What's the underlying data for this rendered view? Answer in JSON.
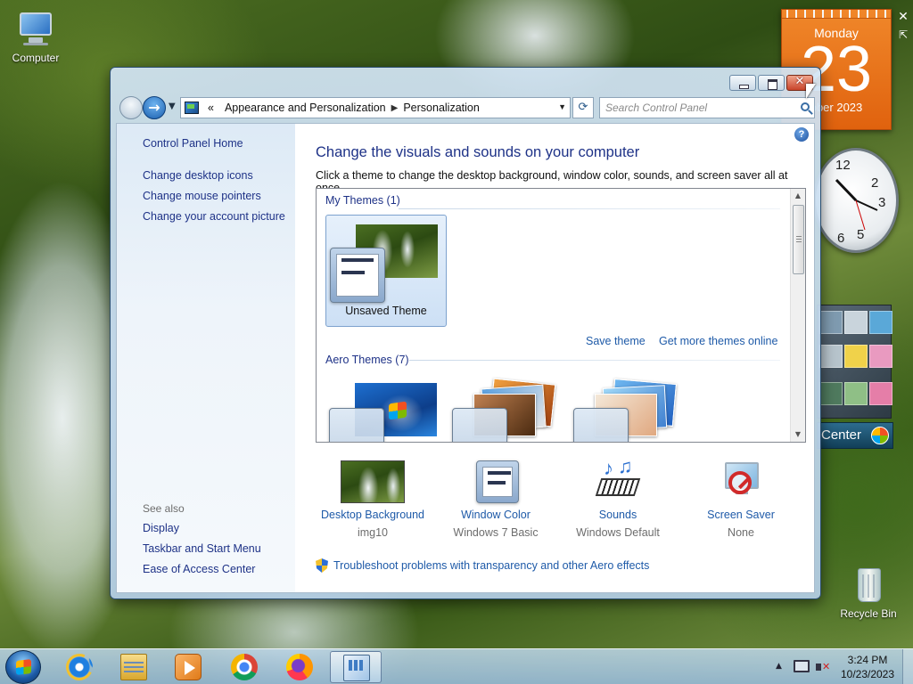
{
  "desktop": {
    "icons": [
      {
        "label": "Computer",
        "icon": "computer-icon"
      },
      {
        "label": "Recycle Bin",
        "icon": "recycle-bin-icon"
      }
    ]
  },
  "gadgets": {
    "calendar": {
      "weekday": "Monday",
      "day": "23",
      "month_year": "ober 2023"
    },
    "clock": {
      "numerals": [
        "12",
        "2",
        "3",
        "5",
        "6"
      ]
    },
    "media_center": {
      "label": "Center"
    }
  },
  "window": {
    "address": {
      "overflow": "«",
      "segments": [
        "Appearance and Personalization",
        "Personalization"
      ],
      "search_placeholder": "Search Control Panel"
    },
    "left_pane": {
      "home": "Control Panel Home",
      "links": [
        "Change desktop icons",
        "Change mouse pointers",
        "Change your account picture"
      ],
      "see_also_label": "See also",
      "see_also": [
        "Display",
        "Taskbar and Start Menu",
        "Ease of Access Center"
      ]
    },
    "main": {
      "title": "Change the visuals and sounds on your computer",
      "subtitle": "Click a theme to change the desktop background, window color, sounds, and screen saver all at once.",
      "my_themes_header": "My Themes (1)",
      "unsaved_theme": "Unsaved Theme",
      "save_theme": "Save theme",
      "get_more": "Get more themes online",
      "aero_header": "Aero Themes (7)"
    },
    "bottom": [
      {
        "label": "Desktop Background",
        "value": "img10",
        "icon": "desktop-background-icon"
      },
      {
        "label": "Window Color",
        "value": "Windows 7 Basic",
        "icon": "window-color-icon"
      },
      {
        "label": "Sounds",
        "value": "Windows Default",
        "icon": "sounds-icon"
      },
      {
        "label": "Screen Saver",
        "value": "None",
        "icon": "screen-saver-icon"
      }
    ],
    "troubleshoot": "Troubleshoot problems with transparency and other Aero effects"
  },
  "taskbar": {
    "apps": [
      "internet-explorer-icon",
      "file-explorer-icon",
      "media-player-icon",
      "chrome-icon",
      "firefox-icon",
      "control-panel-icon"
    ],
    "time": "3:24 PM",
    "date": "10/23/2023"
  }
}
